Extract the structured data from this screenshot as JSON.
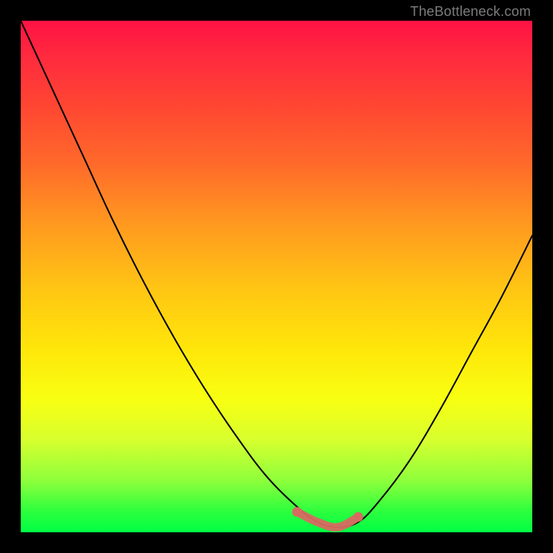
{
  "watermark": "TheBottleneck.com",
  "colors": {
    "curve": "#000000",
    "accent": "#d86a61",
    "frame": "#000000"
  },
  "chart_data": {
    "type": "line",
    "title": "",
    "xlabel": "",
    "ylabel": "",
    "xlim": [
      0,
      100
    ],
    "ylim": [
      0,
      100
    ],
    "grid": false,
    "legend": false,
    "series": [
      {
        "name": "bottleneck-curve",
        "x": [
          0,
          6,
          12,
          18,
          24,
          30,
          36,
          42,
          48,
          54,
          58,
          62,
          66,
          70,
          76,
          82,
          88,
          94,
          100
        ],
        "y": [
          100,
          87,
          74,
          61,
          49,
          38,
          28,
          19,
          11,
          5,
          2,
          1,
          2,
          6,
          14,
          24,
          35,
          46,
          58
        ]
      },
      {
        "name": "optimal-range",
        "x": [
          54,
          58,
          62,
          66
        ],
        "y": [
          4,
          2,
          1,
          3
        ]
      }
    ],
    "annotations": [
      {
        "text": "TheBottleneck.com",
        "position": "top-right"
      }
    ]
  }
}
